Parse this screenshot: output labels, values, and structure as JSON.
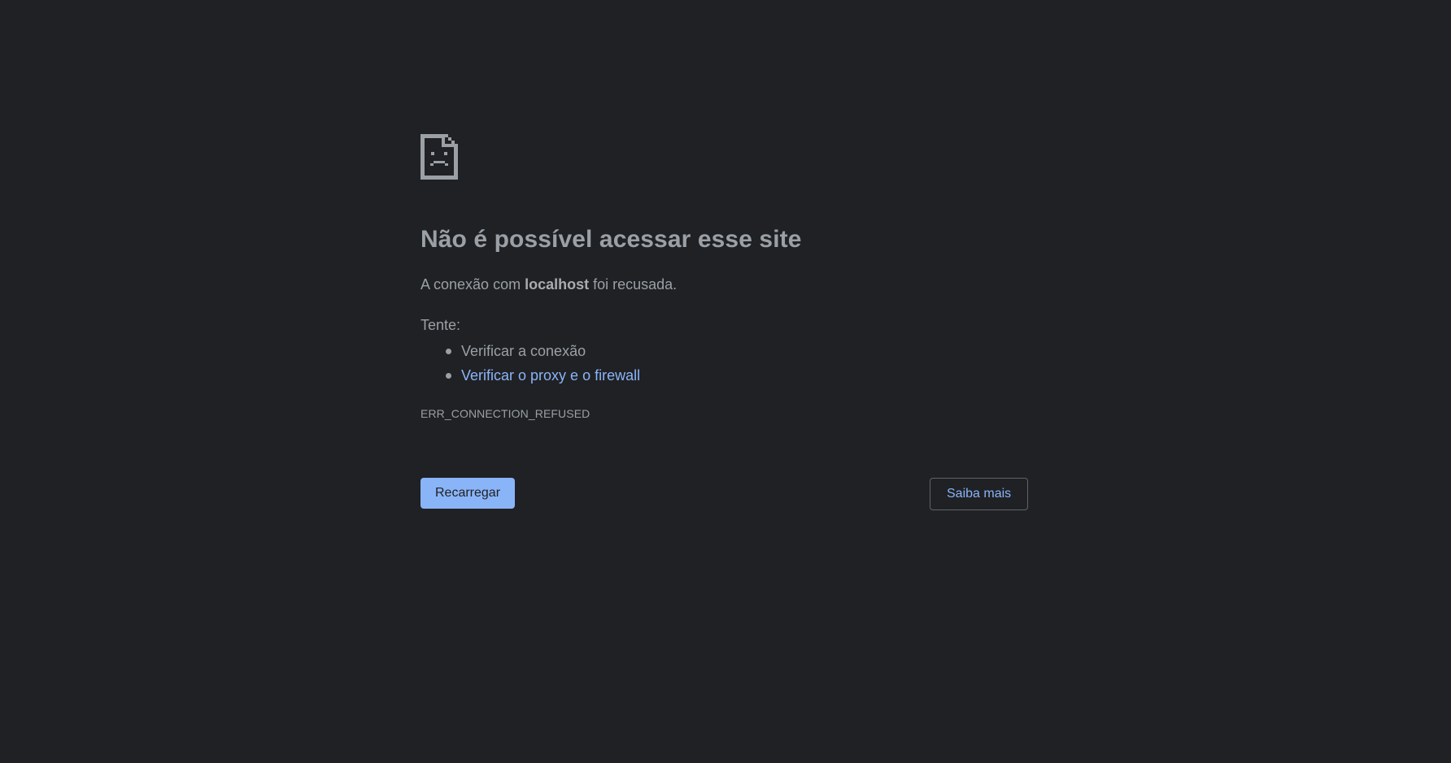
{
  "error_page": {
    "icon": "sad-document-icon",
    "title": "Não é possível acessar esse site",
    "description": {
      "prefix": "A conexão com ",
      "host": "localhost",
      "suffix": " foi recusada."
    },
    "try_label": "Tente:",
    "suggestions": [
      {
        "label": "Verificar a conexão",
        "is_link": false
      },
      {
        "label": "Verificar o proxy e o firewall",
        "is_link": true
      }
    ],
    "error_code": "ERR_CONNECTION_REFUSED",
    "buttons": {
      "reload_label": "Recarregar",
      "learn_more_label": "Saiba mais"
    }
  },
  "colors": {
    "background": "#202124",
    "text": "#9aa0a6",
    "link": "#8ab4f8",
    "primary_button": "#8ab4f8",
    "outline_border": "#5f6368"
  }
}
